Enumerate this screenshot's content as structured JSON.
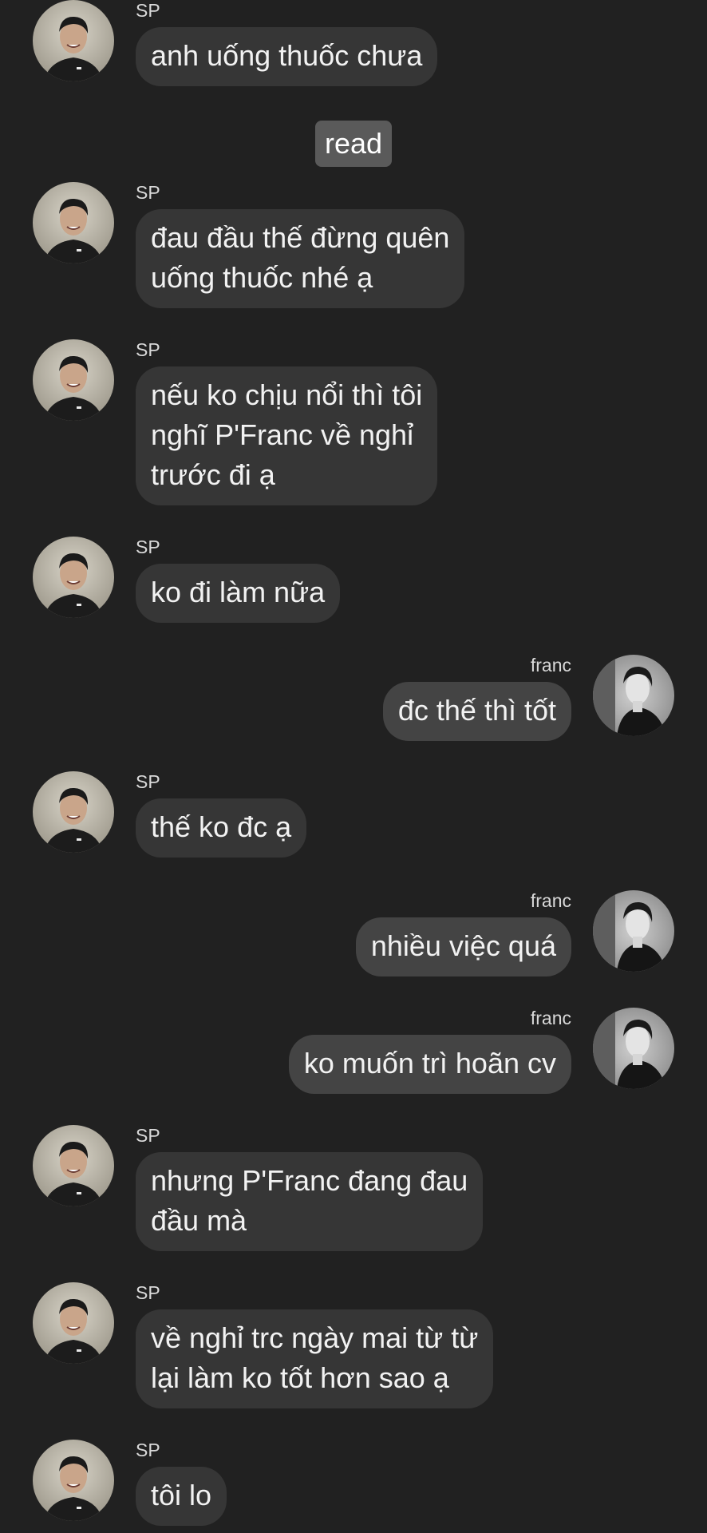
{
  "status": {
    "read_label": "read"
  },
  "messages": [
    {
      "sender": "SP",
      "text": "anh uống thuốc chưa"
    },
    {
      "sender": "SP",
      "text": "đau đầu thế đừng quên\nuống thuốc nhé ạ"
    },
    {
      "sender": "SP",
      "text": "nếu ko chịu nổi thì tôi\nnghĩ P'Franc về nghỉ\ntrước đi ạ"
    },
    {
      "sender": "SP",
      "text": "ko đi làm nữa"
    },
    {
      "sender": "franc",
      "text": "đc thế thì tốt"
    },
    {
      "sender": "SP",
      "text": "thế ko đc ạ"
    },
    {
      "sender": "franc",
      "text": "nhiều việc quá"
    },
    {
      "sender": "franc",
      "text": "ko muốn trì hoãn cv"
    },
    {
      "sender": "SP",
      "text": "nhưng P'Franc đang đau\nđầu mà"
    },
    {
      "sender": "SP",
      "text": "về nghỉ trc ngày mai từ từ\nlại làm ko tốt hơn sao ạ"
    },
    {
      "sender": "SP",
      "text": "tôi lo"
    }
  ],
  "colors": {
    "background": "#212121",
    "incoming_bubble": "#363636",
    "outgoing_bubble": "#444444",
    "read_badge": "#5a5a5a"
  },
  "icons": {
    "sp_avatar": "sp-avatar-photo",
    "franc_avatar": "franc-avatar-photo"
  }
}
